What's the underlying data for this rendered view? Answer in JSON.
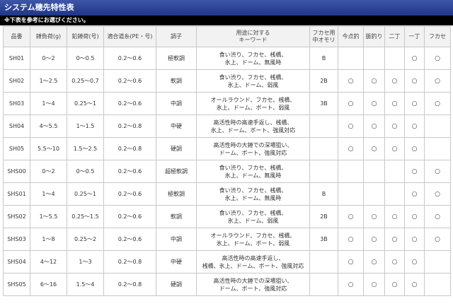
{
  "title": "システム穂先特性表",
  "note": "※下表を参考にお選びください。",
  "headers": {
    "code": "品番",
    "load_sinker": "錘負荷(g)",
    "load_lead": "鉛錘荷(号)",
    "line": "適合道糸(PE・号)",
    "action": "調子",
    "keywords_l1": "用途に対する",
    "keywords_l2": "キーワード",
    "weight_l1": "フカセ用",
    "weight_l2": "中オモリ",
    "tenten": "今点釣",
    "tsuri": "脈釣り",
    "nicho": "二丁",
    "iccho": "一丁",
    "fukase": "フカセ"
  },
  "mark_symbol": "○",
  "rows": [
    {
      "code": "SH01",
      "sinker": "0〜2",
      "lead": "0〜0.5",
      "line": "0.2〜0.6",
      "action": "極軟調",
      "kw1": "食い渋り、フカセ、桟橋、",
      "kw2": "氷上、ドーム、無風時",
      "weight": "B",
      "m": [
        false,
        false,
        false,
        true,
        true
      ]
    },
    {
      "code": "SH02",
      "sinker": "1〜2.5",
      "lead": "0.25〜0.7",
      "line": "0.2〜0.6",
      "action": "軟調",
      "kw1": "食い渋り、フカセ、桟橋、",
      "kw2": "氷上、ドーム、弱風",
      "weight": "2B",
      "m": [
        true,
        true,
        true,
        true,
        true
      ]
    },
    {
      "code": "SH03",
      "sinker": "1〜4",
      "lead": "0.25〜1",
      "line": "0.2〜0.6",
      "action": "中調",
      "kw1": "オールラウンド、フカセ、桟橋、",
      "kw2": "氷上、ドーム、ボート、弱風",
      "weight": "3B",
      "m": [
        true,
        true,
        true,
        true,
        true
      ]
    },
    {
      "code": "SH04",
      "sinker": "4〜5.5",
      "lead": "1〜1.5",
      "line": "0.2〜0.8",
      "action": "中硬",
      "kw1": "高活性時の高速手返し、桟橋、",
      "kw2": "氷上、ドーム、ボート、強風対応",
      "weight": "",
      "m": [
        true,
        true,
        true,
        true,
        false
      ]
    },
    {
      "code": "SH05",
      "sinker": "5.5〜10",
      "lead": "1.5〜2.5",
      "line": "0.2〜0.8",
      "action": "硬調",
      "kw1": "高活性時の大錘での深場狙い、",
      "kw2": "ドーム、ボート、強風対応",
      "weight": "",
      "m": [
        true,
        true,
        true,
        true,
        false
      ]
    },
    {
      "code": "SHS00",
      "sinker": "0〜2",
      "lead": "0〜0.5",
      "line": "0.2〜0.6",
      "action": "超極軟調",
      "kw1": "食い渋り、フカセ、桟橋、",
      "kw2": "氷上、ドーム、無風時",
      "weight": "",
      "m": [
        false,
        false,
        false,
        true,
        true
      ]
    },
    {
      "code": "SHS01",
      "sinker": "1〜4",
      "lead": "0.25〜1",
      "line": "0.2〜0.6",
      "action": "極軟調",
      "kw1": "食い渋り、フカセ、桟橋、",
      "kw2": "氷上、ドーム、無風時",
      "weight": "B",
      "m": [
        false,
        false,
        false,
        true,
        true
      ]
    },
    {
      "code": "SHS02",
      "sinker": "1〜5.5",
      "lead": "0.25〜1.5",
      "line": "0.2〜0.6",
      "action": "軟調",
      "kw1": "食い渋り、フカセ、桟橋、",
      "kw2": "氷上、ドーム、弱風",
      "weight": "2B",
      "m": [
        true,
        true,
        true,
        true,
        true
      ]
    },
    {
      "code": "SHS03",
      "sinker": "1〜8",
      "lead": "0.25〜2",
      "line": "0.2〜0.6",
      "action": "中調",
      "kw1": "オールラウンド、フカセ、桟橋、",
      "kw2": "氷上、ドーム、ボート、弱風",
      "weight": "3B",
      "m": [
        true,
        true,
        true,
        true,
        true
      ]
    },
    {
      "code": "SHS04",
      "sinker": "4〜12",
      "lead": "1〜3",
      "line": "0.2〜0.8",
      "action": "中硬",
      "kw1": "高活性時の高速手返し、",
      "kw2": "桟橋、氷上、ドーム、ボート、強風対応",
      "weight": "",
      "m": [
        true,
        true,
        true,
        true,
        false
      ]
    },
    {
      "code": "SHS05",
      "sinker": "6〜16",
      "lead": "1.5〜4",
      "line": "0.2〜0.8",
      "action": "硬調",
      "kw1": "高活性時の大錘での深場狙い、",
      "kw2": "ドーム、ボート、強風対応",
      "weight": "",
      "m": [
        true,
        true,
        true,
        true,
        false
      ]
    }
  ]
}
